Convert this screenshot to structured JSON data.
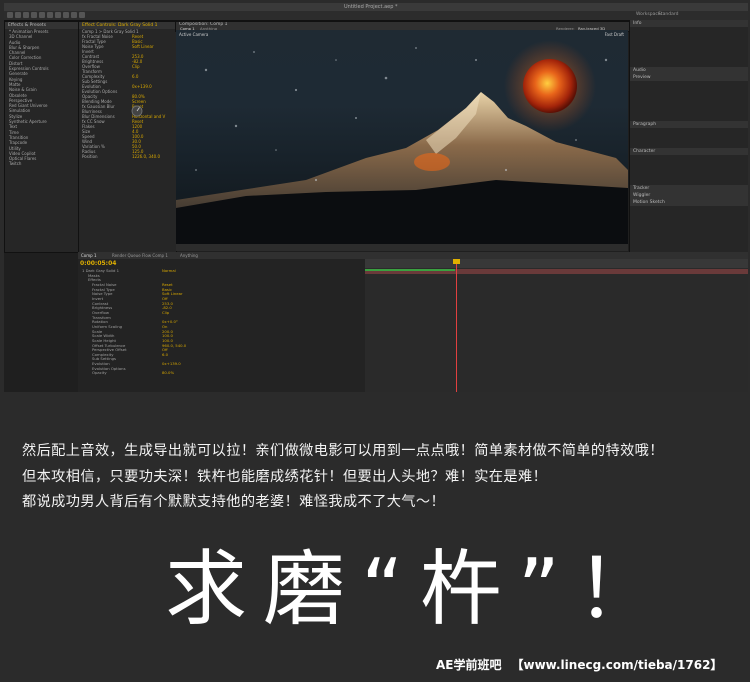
{
  "app": {
    "window_title": "Untitled Project.aep *",
    "workspace_tabs": [
      "Workspace:",
      "Standard"
    ],
    "effects_panel_title": "Effects & Presets",
    "effect_controls_title": "Effect Controls: Dark Gray Solid 1",
    "composition_tab": "Composition: Comp 1",
    "viewer_tabs": [
      "Comp 1",
      "Anything"
    ],
    "active_camera": "Active Camera",
    "renderer": "Renderer:",
    "renderer_value": "Ray-traced 3D",
    "fast_draft": "Fast Draft",
    "timeline_tabs": [
      "Comp 1",
      "Render Queue",
      "Flow Comp 1",
      "Anything"
    ],
    "timecode": "0:00:05:04",
    "right_panels": [
      "Info",
      "Audio",
      "Preview",
      "Paragraph",
      "Character",
      "Tracker",
      "Wiggler",
      "Motion Sketch"
    ]
  },
  "effects_tree": [
    "* Animation Presets",
    "3D Channel",
    "Audio",
    "Blur & Sharpen",
    "Channel",
    "Color Correction",
    "Distort",
    "Expression Controls",
    "Generate",
    "Keying",
    "Matte",
    "Noise & Grain",
    "Obsolete",
    "Perspective",
    "Red Giant Universe",
    "Simulation",
    "Stylize",
    "Synthetic Aperture",
    "Text",
    "Time",
    "Transition",
    "Trapcode",
    "Utility",
    "Video Copilot",
    "Optical Flares",
    "Twitch"
  ],
  "effect_controls": [
    {
      "label": "Comp 1 > Dark Gray Solid 1",
      "value": ""
    },
    {
      "label": "fx  Fractal Noise",
      "value": "Reset"
    },
    {
      "label": "Fractal Type",
      "value": "Basic"
    },
    {
      "label": "Noise Type",
      "value": "Soft Linear"
    },
    {
      "label": "Invert",
      "value": ""
    },
    {
      "label": "Contrast",
      "value": "253.0"
    },
    {
      "label": "Brightness",
      "value": "-82.0"
    },
    {
      "label": "Overflow",
      "value": "Clip"
    },
    {
      "label": "Transform",
      "value": ""
    },
    {
      "label": "Complexity",
      "value": "6.0"
    },
    {
      "label": "Sub Settings",
      "value": ""
    },
    {
      "label": "Evolution",
      "value": "0x+139.0"
    },
    {
      "label": "Evolution Options",
      "value": ""
    },
    {
      "label": "Opacity",
      "value": "80.0%"
    },
    {
      "label": "Blending Mode",
      "value": "Screen"
    },
    {
      "label": "fx  Gaussian Blur",
      "value": "Reset"
    },
    {
      "label": "Blurriness",
      "value": "3.0"
    },
    {
      "label": "Blur Dimensions",
      "value": "Horizontal and V"
    },
    {
      "label": "fx  CC Snow",
      "value": "Reset"
    },
    {
      "label": "Flakes",
      "value": "1200"
    },
    {
      "label": "Size",
      "value": "4.0"
    },
    {
      "label": "Speed",
      "value": "100.0"
    },
    {
      "label": "Wind",
      "value": "30.0"
    },
    {
      "label": "Variation %",
      "value": "50.0"
    },
    {
      "label": "Radius",
      "value": "125.0"
    },
    {
      "label": "Position",
      "value": "1226.0, 340.0"
    }
  ],
  "timeline_layers": [
    {
      "label": "1  Dark Gray Solid 1",
      "value": "Normal"
    },
    {
      "label": "Masks",
      "value": ""
    },
    {
      "label": "Effects",
      "value": ""
    },
    {
      "label": "Fractal Noise",
      "value": "Reset"
    },
    {
      "label": "Fractal Type",
      "value": "Basic"
    },
    {
      "label": "Noise Type",
      "value": "Soft Linear"
    },
    {
      "label": "Invert",
      "value": "Off"
    },
    {
      "label": "Contrast",
      "value": "253.0"
    },
    {
      "label": "Brightness",
      "value": "-82.0"
    },
    {
      "label": "Overflow",
      "value": "Clip"
    },
    {
      "label": "Transform",
      "value": ""
    },
    {
      "label": "Rotation",
      "value": "0x+0.0°"
    },
    {
      "label": "Uniform Scaling",
      "value": "On"
    },
    {
      "label": "Scale",
      "value": "200.0"
    },
    {
      "label": "Scale Width",
      "value": "100.0"
    },
    {
      "label": "Scale Height",
      "value": "100.0"
    },
    {
      "label": "Offset Turbulence",
      "value": "960.0, 540.0"
    },
    {
      "label": "Perspective Offset",
      "value": "Off"
    },
    {
      "label": "Complexity",
      "value": "6.0"
    },
    {
      "label": "Sub Settings",
      "value": ""
    },
    {
      "label": "Evolution",
      "value": "0x+139.0"
    },
    {
      "label": "Evolution Options",
      "value": ""
    },
    {
      "label": "Opacity",
      "value": "80.0%"
    }
  ],
  "caption": {
    "line1": "然后配上音效，生成导出就可以拉！亲们做微电影可以用到一点点哦！简单素材做不简单的特效哦！",
    "line2": "但本攻相信，只要功夫深！铁杵也能磨成绣花针！但要出人头地？难！实在是难！",
    "line3": "都说成功男人背后有个默默支持他的老婆！难怪我成不了大气～！",
    "big_text": "求磨“杵”！",
    "watermark_brand": "AE学前班吧",
    "watermark_url": "【www.linecg.com/tieba/1762】"
  },
  "colors": {
    "accent": "#e0b000",
    "moon": "#d14a10",
    "background": "#2b2b2b"
  }
}
